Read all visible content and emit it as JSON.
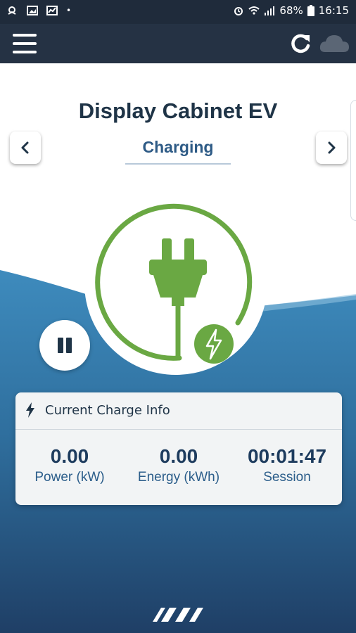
{
  "status_bar": {
    "battery": "68%",
    "time": "16:15"
  },
  "main": {
    "title": "Display Cabinet EV",
    "status": "Charging"
  },
  "card": {
    "title": "Current Charge Info",
    "metrics": [
      {
        "value": "0.00",
        "label": "Power (kW)"
      },
      {
        "value": "0.00",
        "label": "Energy (kWh)"
      },
      {
        "value": "00:01:47",
        "label": "Session"
      }
    ]
  },
  "colors": {
    "appbar": "#253244",
    "accent_green": "#6aa843",
    "wave_blue": "#3a86b8",
    "title_navy": "#1f3447"
  },
  "icons": [
    "notification-icon",
    "image-icon",
    "chart-icon",
    "alarm-icon",
    "wifi-icon",
    "signal-icon",
    "battery-icon",
    "menu-icon",
    "refresh-icon",
    "cloud-icon",
    "chevron-left-icon",
    "chevron-right-icon",
    "plug-icon",
    "lightning-badge-icon",
    "pause-icon",
    "bolt-icon",
    "brand-logo"
  ]
}
